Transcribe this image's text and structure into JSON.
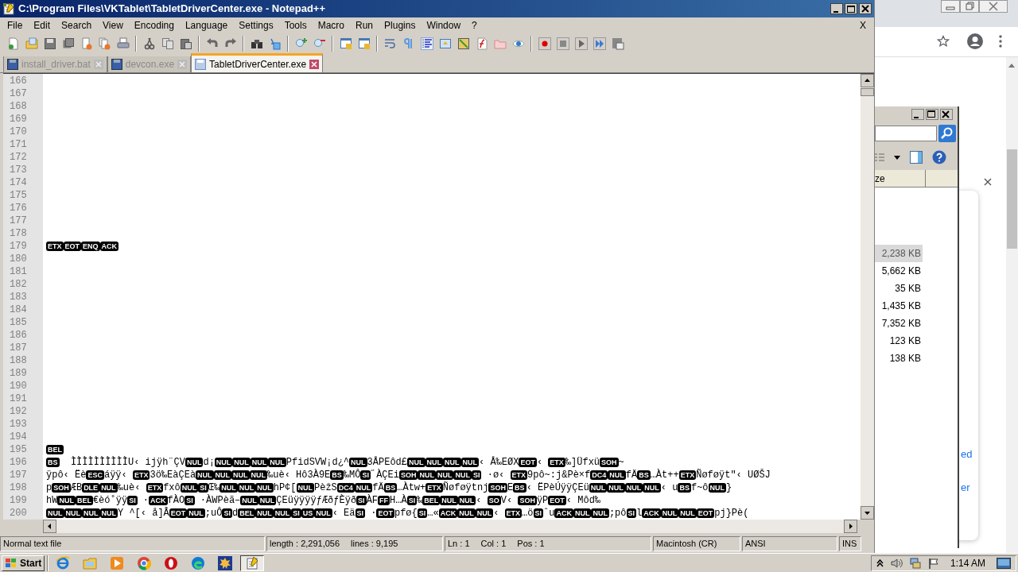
{
  "window": {
    "title": "C:\\Program Files\\VKTablet\\TabletDriverCenter.exe - Notepad++",
    "close_doc": "X"
  },
  "menu": [
    "File",
    "Edit",
    "Search",
    "View",
    "Encoding",
    "Language",
    "Settings",
    "Tools",
    "Macro",
    "Run",
    "Plugins",
    "Window",
    "?"
  ],
  "tabs": [
    {
      "label": "install_driver.bat",
      "selected": false
    },
    {
      "label": "devcon.exe",
      "selected": false
    },
    {
      "label": "TabletDriverCenter.exe",
      "selected": true
    }
  ],
  "editor": {
    "lines": [
      {
        "number": "166"
      },
      {
        "number": "167"
      },
      {
        "number": "168"
      },
      {
        "number": "169"
      },
      {
        "number": "170"
      },
      {
        "number": "171"
      },
      {
        "number": "172"
      },
      {
        "number": "173"
      },
      {
        "number": "174"
      },
      {
        "number": "175"
      },
      {
        "number": "176"
      },
      {
        "number": "177"
      },
      {
        "number": "178"
      },
      {
        "number": "179",
        "segments": [
          {
            "kind": "ctrl",
            "text": "ETX"
          },
          {
            "kind": "ctrl",
            "text": "EOT"
          },
          {
            "kind": "ctrl",
            "text": "ENQ"
          },
          {
            "kind": "ctrl",
            "text": "ACK"
          }
        ]
      },
      {
        "number": "180"
      },
      {
        "number": "181"
      },
      {
        "number": "182"
      },
      {
        "number": "183"
      },
      {
        "number": "184"
      },
      {
        "number": "185"
      },
      {
        "number": "186"
      },
      {
        "number": "187"
      },
      {
        "number": "188"
      },
      {
        "number": "189"
      },
      {
        "number": "190"
      },
      {
        "number": "191"
      },
      {
        "number": "192"
      },
      {
        "number": "193"
      },
      {
        "number": "194"
      },
      {
        "number": "195",
        "segments": [
          {
            "kind": "ctrl",
            "text": "BEL"
          }
        ]
      },
      {
        "number": "196",
        "segments": [
          {
            "kind": "ctrl",
            "text": "BS"
          },
          {
            "kind": "plain",
            "text": "  ÌÌÌÌÌÌÌÌÌÌU‹ ijÿh¨ÇV"
          },
          {
            "kind": "ctrl",
            "text": "NUL"
          },
          {
            "kind": "plain",
            "text": "d¡"
          },
          {
            "kind": "ctrl",
            "text": "NUL"
          },
          {
            "kind": "ctrl",
            "text": "NUL"
          },
          {
            "kind": "ctrl",
            "text": "NUL"
          },
          {
            "kind": "ctrl",
            "text": "NUL"
          },
          {
            "kind": "plain",
            "text": "PfidSVW¡d¿^"
          },
          {
            "kind": "ctrl",
            "text": "NUL"
          },
          {
            "kind": "plain",
            "text": "3ÅPEôd£"
          },
          {
            "kind": "ctrl",
            "text": "NUL"
          },
          {
            "kind": "ctrl",
            "text": "NUL"
          },
          {
            "kind": "ctrl",
            "text": "NUL"
          },
          {
            "kind": "ctrl",
            "text": "NUL"
          },
          {
            "kind": "plain",
            "text": "‹ Å‰EØX"
          },
          {
            "kind": "ctrl",
            "text": "EOT"
          },
          {
            "kind": "plain",
            "text": "‹ "
          },
          {
            "kind": "ctrl",
            "text": "ETX"
          },
          {
            "kind": "plain",
            "text": "‰]Üfxü"
          },
          {
            "kind": "ctrl",
            "text": "SOH"
          },
          {
            "kind": "plain",
            "text": "~"
          }
        ]
      },
      {
        "number": "197",
        "segments": [
          {
            "kind": "plain",
            "text": "ÿpô‹ Ëè"
          },
          {
            "kind": "ctrl",
            "text": "ESC"
          },
          {
            "kind": "plain",
            "text": "áÿÿ‹ "
          },
          {
            "kind": "ctrl",
            "text": "ETX"
          },
          {
            "kind": "plain",
            "text": "3ö‰EàÇEà"
          },
          {
            "kind": "ctrl",
            "text": "NUL"
          },
          {
            "kind": "ctrl",
            "text": "NUL"
          },
          {
            "kind": "ctrl",
            "text": "NUL"
          },
          {
            "kind": "ctrl",
            "text": "NUL"
          },
          {
            "kind": "plain",
            "text": "‰uè‹ Hô3À9E"
          },
          {
            "kind": "ctrl",
            "text": "BS"
          },
          {
            "kind": "plain",
            "text": "‰MÔ"
          },
          {
            "kind": "ctrl",
            "text": "SI"
          },
          {
            "kind": "plain",
            "text": "˝ÀÇEi"
          },
          {
            "kind": "ctrl",
            "text": "SOH"
          },
          {
            "kind": "ctrl",
            "text": "NUL"
          },
          {
            "kind": "ctrl",
            "text": "NUL"
          },
          {
            "kind": "ctrl",
            "text": "NUL"
          },
          {
            "kind": "ctrl",
            "text": "SI"
          },
          {
            "kind": "plain",
            "text": " ·ø‹ "
          },
          {
            "kind": "ctrl",
            "text": "ETX"
          },
          {
            "kind": "plain",
            "text": "9pô~:j&Pè×f"
          },
          {
            "kind": "ctrl",
            "text": "DC4"
          },
          {
            "kind": "ctrl",
            "text": "NUL"
          },
          {
            "kind": "plain",
            "text": "fÄ"
          },
          {
            "kind": "ctrl",
            "text": "BS"
          },
          {
            "kind": "plain",
            "text": "…Àt++"
          },
          {
            "kind": "ctrl",
            "text": "ETX"
          },
          {
            "kind": "plain",
            "text": "Ñøføÿt\"‹ UØŠJ"
          }
        ]
      },
      {
        "number": "198",
        "segments": [
          {
            "kind": "plain",
            "text": "p"
          },
          {
            "kind": "ctrl",
            "text": "SOH"
          },
          {
            "kind": "plain",
            "text": "ÆB"
          },
          {
            "kind": "ctrl",
            "text": "DLE"
          },
          {
            "kind": "ctrl",
            "text": "NUL"
          },
          {
            "kind": "plain",
            "text": "‰uè‹ "
          },
          {
            "kind": "ctrl",
            "text": "ETX"
          },
          {
            "kind": "plain",
            "text": "fxô"
          },
          {
            "kind": "ctrl",
            "text": "NUL"
          },
          {
            "kind": "ctrl",
            "text": "SI"
          },
          {
            "kind": "plain",
            "text": "Œ‰"
          },
          {
            "kind": "ctrl",
            "text": "NUL"
          },
          {
            "kind": "ctrl",
            "text": "NUL"
          },
          {
            "kind": "ctrl",
            "text": "NUL"
          },
          {
            "kind": "plain",
            "text": "hP¢["
          },
          {
            "kind": "ctrl",
            "text": "NUL"
          },
          {
            "kind": "plain",
            "text": "PèžS"
          },
          {
            "kind": "ctrl",
            "text": "DC4"
          },
          {
            "kind": "ctrl",
            "text": "NUL"
          },
          {
            "kind": "plain",
            "text": "fÄ"
          },
          {
            "kind": "ctrl",
            "text": "BS"
          },
          {
            "kind": "plain",
            "text": "…Àtw+"
          },
          {
            "kind": "ctrl",
            "text": "ETX"
          },
          {
            "kind": "plain",
            "text": "Ñøføÿtnj"
          },
          {
            "kind": "ctrl",
            "text": "SOH"
          },
          {
            "kind": "plain",
            "text": "E"
          },
          {
            "kind": "ctrl",
            "text": "BS"
          },
          {
            "kind": "plain",
            "text": "‹ ËPèÚÿÿÇEü"
          },
          {
            "kind": "ctrl",
            "text": "NUL"
          },
          {
            "kind": "ctrl",
            "text": "NUL"
          },
          {
            "kind": "ctrl",
            "text": "NUL"
          },
          {
            "kind": "ctrl",
            "text": "NUL"
          },
          {
            "kind": "plain",
            "text": "‹ u"
          },
          {
            "kind": "ctrl",
            "text": "BS"
          },
          {
            "kind": "plain",
            "text": "f~ô"
          },
          {
            "kind": "ctrl",
            "text": "NUL"
          },
          {
            "kind": "plain",
            "text": "}"
          }
        ]
      },
      {
        "number": "199",
        "segments": [
          {
            "kind": "plain",
            "text": "hW"
          },
          {
            "kind": "ctrl",
            "text": "NUL"
          },
          {
            "kind": "ctrl",
            "text": "BEL"
          },
          {
            "kind": "plain",
            "text": "€èó˚ÿÿ"
          },
          {
            "kind": "ctrl",
            "text": "SI"
          },
          {
            "kind": "plain",
            "text": " ·"
          },
          {
            "kind": "ctrl",
            "text": "ACK"
          },
          {
            "kind": "plain",
            "text": "fÀO"
          },
          {
            "kind": "ctrl",
            "text": "SI"
          },
          {
            "kind": "plain",
            "text": " ·ÀWPèã–"
          },
          {
            "kind": "ctrl",
            "text": "NUL"
          },
          {
            "kind": "ctrl",
            "text": "NUL"
          },
          {
            "kind": "plain",
            "text": "ÇEüÿÿÿÿƒÆðƒÈÿð"
          },
          {
            "kind": "ctrl",
            "text": "SI"
          },
          {
            "kind": "plain",
            "text": "ÀF"
          },
          {
            "kind": "ctrl",
            "text": "FF"
          },
          {
            "kind": "plain",
            "text": "H…À"
          },
          {
            "kind": "ctrl",
            "text": "SI"
          },
          {
            "kind": "plain",
            "text": "‰"
          },
          {
            "kind": "ctrl",
            "text": "BEL"
          },
          {
            "kind": "ctrl",
            "text": "NUL"
          },
          {
            "kind": "ctrl",
            "text": "NUL"
          },
          {
            "kind": "plain",
            "text": "‹ "
          },
          {
            "kind": "ctrl",
            "text": "SO"
          },
          {
            "kind": "plain",
            "text": "V‹ "
          },
          {
            "kind": "ctrl",
            "text": "SOH"
          },
          {
            "kind": "plain",
            "text": "ÿP"
          },
          {
            "kind": "ctrl",
            "text": "EOT"
          },
          {
            "kind": "plain",
            "text": "‹ Môd‰"
          }
        ]
      },
      {
        "number": "200",
        "segments": [
          {
            "kind": "ctrl",
            "text": "NUL"
          },
          {
            "kind": "ctrl",
            "text": "NUL"
          },
          {
            "kind": "ctrl",
            "text": "NUL"
          },
          {
            "kind": "ctrl",
            "text": "NUL"
          },
          {
            "kind": "plain",
            "text": "Y ^[‹ å]Â"
          },
          {
            "kind": "ctrl",
            "text": "EOT"
          },
          {
            "kind": "ctrl",
            "text": "NUL"
          },
          {
            "kind": "plain",
            "text": ";uÔ"
          },
          {
            "kind": "ctrl",
            "text": "SI"
          },
          {
            "kind": "plain",
            "text": "d"
          },
          {
            "kind": "ctrl",
            "text": "BEL"
          },
          {
            "kind": "ctrl",
            "text": "NUL"
          },
          {
            "kind": "ctrl",
            "text": "NUL"
          },
          {
            "kind": "ctrl",
            "text": "SI"
          },
          {
            "kind": "ctrl",
            "text": "US"
          },
          {
            "kind": "ctrl",
            "text": "NUL"
          },
          {
            "kind": "plain",
            "text": "‹ Eä"
          },
          {
            "kind": "ctrl",
            "text": "SI"
          },
          {
            "kind": "plain",
            "text": " ·"
          },
          {
            "kind": "ctrl",
            "text": "EOT"
          },
          {
            "kind": "plain",
            "text": "pfø{"
          },
          {
            "kind": "ctrl",
            "text": "SI"
          },
          {
            "kind": "plain",
            "text": "…«"
          },
          {
            "kind": "ctrl",
            "text": "ACK"
          },
          {
            "kind": "ctrl",
            "text": "NUL"
          },
          {
            "kind": "ctrl",
            "text": "NUL"
          },
          {
            "kind": "plain",
            "text": "‹ "
          },
          {
            "kind": "ctrl",
            "text": "ETX"
          },
          {
            "kind": "plain",
            "text": "…ö"
          },
          {
            "kind": "ctrl",
            "text": "SI"
          },
          {
            "kind": "plain",
            "text": "ˆu"
          },
          {
            "kind": "ctrl",
            "text": "ACK"
          },
          {
            "kind": "ctrl",
            "text": "NUL"
          },
          {
            "kind": "ctrl",
            "text": "NUL"
          },
          {
            "kind": "plain",
            "text": ";pô"
          },
          {
            "kind": "ctrl",
            "text": "SI"
          },
          {
            "kind": "plain",
            "text": "l"
          },
          {
            "kind": "ctrl",
            "text": "ACK"
          },
          {
            "kind": "ctrl",
            "text": "NUL"
          },
          {
            "kind": "ctrl",
            "text": "NUL"
          },
          {
            "kind": "ctrl",
            "text": "EOT"
          },
          {
            "kind": "plain",
            "text": "pj}Pè("
          }
        ]
      }
    ]
  },
  "status_bar": [
    [
      "Normal text file"
    ],
    [
      "length : 2,291,056",
      "lines : 9,195"
    ],
    [
      "Ln : 1",
      "Col : 1",
      "Pos : 1"
    ],
    [
      "Macintosh (CR)"
    ],
    [
      "ANSI"
    ],
    [
      "INS"
    ]
  ],
  "explorer": {
    "column": "ze",
    "sizes": [
      {
        "text": "2,238 KB",
        "selected": true
      },
      {
        "text": "5,662 KB",
        "selected": false
      },
      {
        "text": "35 KB",
        "selected": false
      },
      {
        "text": "1,435 KB",
        "selected": false
      },
      {
        "text": "7,352 KB",
        "selected": false
      },
      {
        "text": "123 KB",
        "selected": false
      },
      {
        "text": "138 KB",
        "selected": false
      }
    ]
  },
  "browser": {
    "fragments": [
      "ed",
      "er"
    ]
  },
  "taskbar": {
    "start": "Start",
    "clock": "1:14 AM"
  }
}
